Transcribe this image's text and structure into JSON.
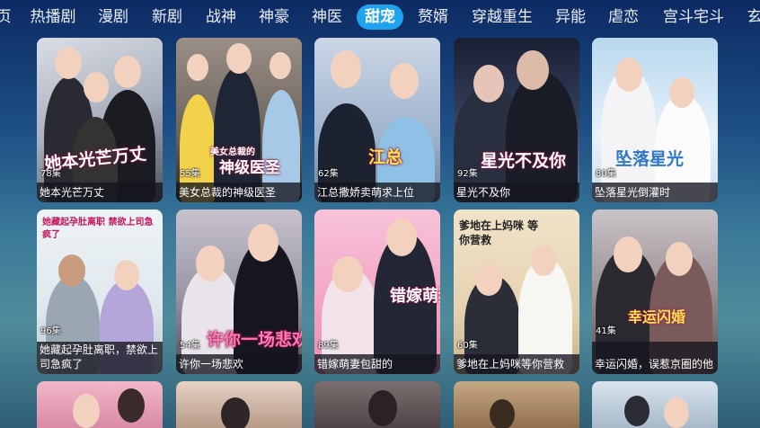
{
  "tabs": [
    "页",
    "热播剧",
    "漫剧",
    "新剧",
    "战神",
    "神豪",
    "神医",
    "甜宠",
    "赘婿",
    "穿越重生",
    "异能",
    "虐恋",
    "宫斗宅斗",
    "玄"
  ],
  "active_tab": "甜宠",
  "colors": {
    "accent": "#1fa3ef"
  },
  "cards": [
    {
      "title": "她本光芒万丈",
      "episodes": "78集",
      "overlay": "她本光芒万丈"
    },
    {
      "title": "美女总裁的神级医圣",
      "episodes": "55集",
      "overlay": "神级医圣",
      "overlay_small": "美女总裁的"
    },
    {
      "title": "江总撒娇卖萌求上位",
      "episodes": "62集",
      "overlay": "江总"
    },
    {
      "title": "星光不及你",
      "episodes": "92集",
      "overlay": "星光不及你"
    },
    {
      "title": "坠落星光倒灌时",
      "episodes": "80集",
      "overlay": "坠落星光"
    },
    {
      "title": "她藏起孕肚离职，禁欲上司急疯了",
      "episodes": "96集",
      "overlay": "她藏起孕肚离职 禁欲上司急疯了"
    },
    {
      "title": "许你一场悲欢",
      "episodes": "54集",
      "overlay": "许你一场悲欢"
    },
    {
      "title": "错嫁萌妻包甜的",
      "episodes": "89集",
      "overlay": "错嫁萌妻"
    },
    {
      "title": "爹地在上妈咪等你营救",
      "episodes": "60集",
      "overlay": "爹地在上妈咪 等你营救"
    },
    {
      "title": "幸运闪婚，误惹京圈的他",
      "episodes": "41集",
      "overlay": "幸运闪婚"
    }
  ]
}
